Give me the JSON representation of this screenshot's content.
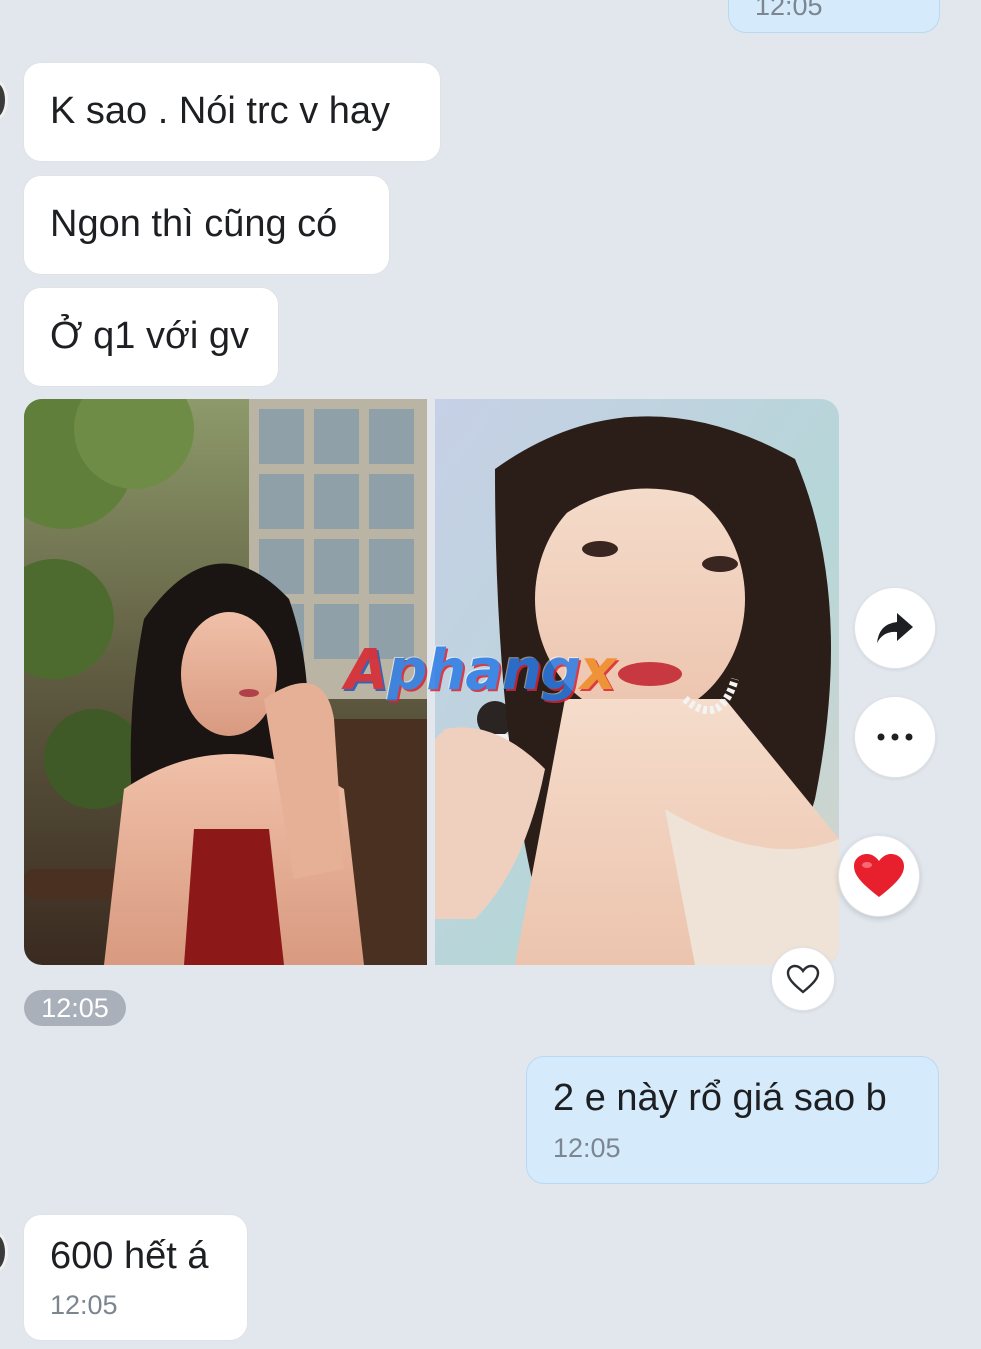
{
  "conversation": {
    "top_sent_time": "12:05",
    "received": [
      {
        "text": "K sao . Nói trc v hay"
      },
      {
        "text": "Ngon thì cũng có"
      },
      {
        "text": "Ở q1 với gv"
      }
    ],
    "photo_message": {
      "photo_count": 2,
      "time": "12:05",
      "watermark": "Aphangx"
    },
    "sent_message": {
      "text": "2 e này rổ giá sao b",
      "time": "12:05"
    },
    "last_received": {
      "text": "600 hết á",
      "time": "12:05"
    }
  },
  "actions": {
    "forward_icon": "forward-arrow-icon",
    "more_icon": "more-horizontal-icon",
    "reaction_icon": "red-heart-icon",
    "like_icon": "heart-outline-icon"
  },
  "colors": {
    "background": "#e2e7ee",
    "received_bubble": "#ffffff",
    "sent_bubble": "#d5ebfb",
    "heart_red": "#e8202e",
    "time_pill": "#a9b0b9"
  }
}
